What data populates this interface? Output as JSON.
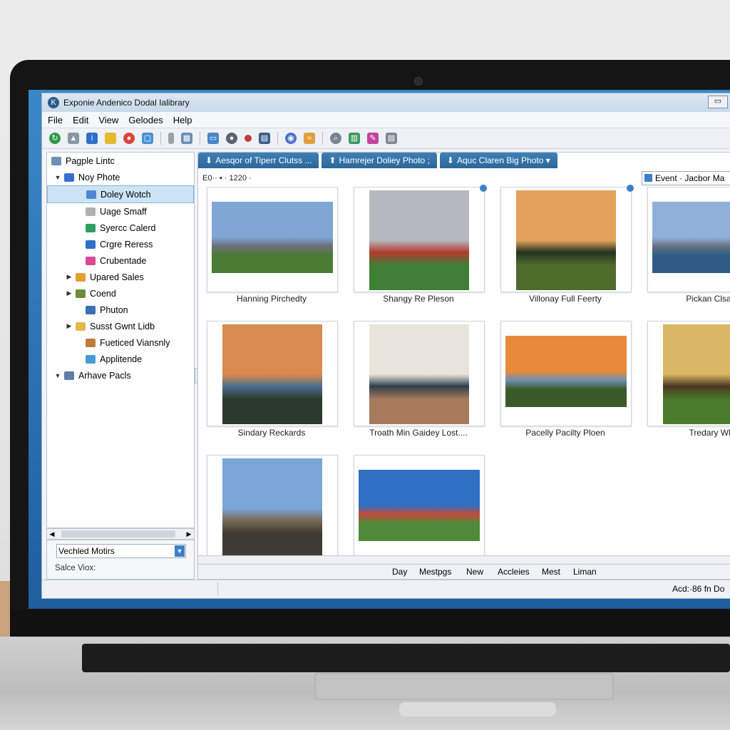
{
  "window": {
    "title": "Exponie Andenico Dodal Ialibrary"
  },
  "menu": [
    "File",
    "Edit",
    "View",
    "Gelodes",
    "Help"
  ],
  "sidebar": {
    "root_label": "Pagple Lintc",
    "items": [
      {
        "label": "Noy Phote",
        "twisty": "▼",
        "color": "#3a6fd0",
        "indent": 10
      },
      {
        "label": "Doley Wotch",
        "twisty": "",
        "color": "#4f86d6",
        "indent": 40,
        "selected": true
      },
      {
        "label": "Uage Smaff",
        "twisty": "",
        "color": "#b0b0b0",
        "indent": 40
      },
      {
        "label": "Syercc Calerd",
        "twisty": "",
        "color": "#2f9e5f",
        "indent": 40
      },
      {
        "label": "Crgre Reress",
        "twisty": "",
        "color": "#2f6fc8",
        "indent": 40
      },
      {
        "label": "Crubentade",
        "twisty": "",
        "color": "#d94a98",
        "indent": 40
      },
      {
        "label": "Upared Sales",
        "twisty": "▶",
        "color": "#e0a030",
        "indent": 26
      },
      {
        "label": "Coend",
        "twisty": "▶",
        "color": "#6a8d3a",
        "indent": 26
      },
      {
        "label": "Phuton",
        "twisty": "",
        "color": "#3b6fb8",
        "indent": 40
      },
      {
        "label": "Susst Gwnt Lidb",
        "twisty": "▶",
        "color": "#e2b84a",
        "indent": 26
      },
      {
        "label": "Fueticed Viansnly",
        "twisty": "",
        "color": "#c27a3c",
        "indent": 40
      },
      {
        "label": "Applitende",
        "twisty": "",
        "color": "#4a9ad6",
        "indent": 40
      },
      {
        "label": "Arhave Pacls",
        "twisty": "▼",
        "color": "#5f7ea3",
        "indent": 10
      }
    ],
    "filter": "Vechled Motirs",
    "footer": "Salce Viox:"
  },
  "tabs": [
    {
      "label": "Aesqor of Tiperr Clutss ...",
      "glyph": "⬇"
    },
    {
      "label": "Hamrejer Doliey Photo ;",
      "glyph": "⬆"
    },
    {
      "label": "Aquc Claren Big Photo ▾",
      "glyph": "⬇"
    }
  ],
  "subbar": {
    "text": "E0·· ▪ · 1220 ·"
  },
  "event_field": "Event · Jacbor Ma",
  "photos": [
    {
      "caption": "Hanning Pirchedty",
      "sky": "#7fa6d4",
      "ground": "#4b7a34",
      "accent": "#6c6f7a"
    },
    {
      "caption": "Shangy Re Pleson",
      "sky": "#b5b9bf",
      "ground": "#3f7f36",
      "accent": "#b23a2c"
    },
    {
      "caption": "Villonay Full Feerty",
      "sky": "#e4a25a",
      "ground": "#4f6c2c",
      "accent": "#23331f"
    },
    {
      "caption": "Pickan Clsa d",
      "sky": "#8fb0d8",
      "ground": "#2f5c84",
      "accent": "#6a7382"
    },
    {
      "caption": "Sindary Reckards",
      "sky": "#d98a4f",
      "ground": "#2b3a2a",
      "accent": "#4b6f8f"
    },
    {
      "caption": "Troath Min Gaidey Lost....",
      "sky": "#e8e4dc",
      "ground": "#a77a5c",
      "accent": "#30404c"
    },
    {
      "caption": "Pacelly Pacilty Ploen",
      "sky": "#e88a3a",
      "ground": "#3b5a2a",
      "accent": "#6d91b0"
    },
    {
      "caption": "Tredary Whi",
      "sky": "#d9b764",
      "ground": "#4a7b2c",
      "accent": "#4a3620"
    },
    {
      "caption": "",
      "sky": "#7ba6d8",
      "ground": "#3f3a34",
      "accent": "#7a6a56"
    },
    {
      "caption": "",
      "sky": "#2f6fc4",
      "ground": "#4f8a3a",
      "accent": "#c44a3a"
    }
  ],
  "viewbar": [
    "Day",
    "Mestpgs",
    "New",
    "Accleies",
    "Mest",
    "Liman"
  ],
  "status": "Acd:·86 fn Do"
}
